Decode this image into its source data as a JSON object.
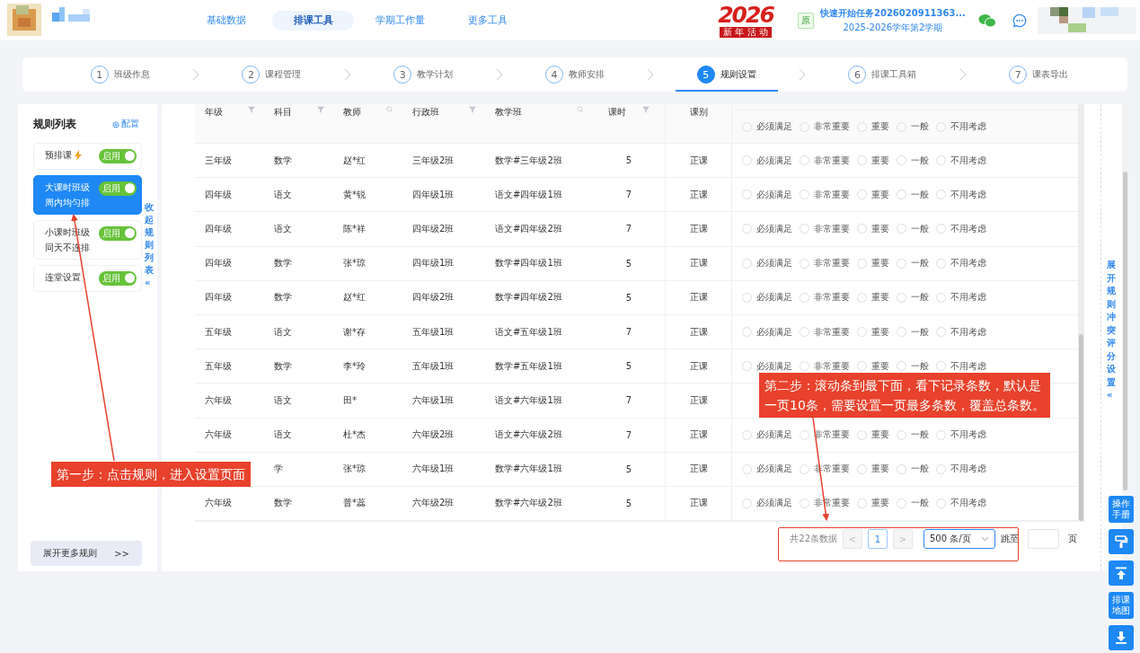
{
  "header": {
    "nav": [
      {
        "label": "基础数据",
        "selected": false
      },
      {
        "label": "排课工具",
        "selected": true
      },
      {
        "label": "学期工作量",
        "selected": false
      },
      {
        "label": "更多工具",
        "selected": false
      }
    ],
    "banner": {
      "year": "2026",
      "caption": "新 年 活 动"
    },
    "task": {
      "badge": "原",
      "title": "快速开始任务2026020911363...",
      "term": "2025-2026学年第2学期"
    }
  },
  "steps": [
    {
      "number": "1",
      "label": "班级作息",
      "selected": false
    },
    {
      "number": "2",
      "label": "课程管理",
      "selected": false
    },
    {
      "number": "3",
      "label": "教学计划",
      "selected": false
    },
    {
      "number": "4",
      "label": "教师安排",
      "selected": false
    },
    {
      "number": "5",
      "label": "规则设置",
      "selected": true
    },
    {
      "number": "6",
      "label": "排课工具箱",
      "selected": false
    },
    {
      "number": "7",
      "label": "课表导出",
      "selected": false
    }
  ],
  "rules_panel": {
    "title": "规则列表",
    "config_link": "配置",
    "collapse": "收起规则列表",
    "collapse_arrow": "«",
    "more_button": "展开更多规则",
    "more_arrow": ">>",
    "rules": [
      {
        "kind": "flash",
        "lines": [
          "预排课"
        ],
        "switch_label": "启用",
        "on": true,
        "selected": false
      },
      {
        "kind": "plain",
        "lines": [
          "大课时班级",
          "周内均匀排"
        ],
        "switch_label": "启用",
        "on": true,
        "selected": true
      },
      {
        "kind": "plain",
        "lines": [
          "小课时班级",
          "同天不连排"
        ],
        "switch_label": "启用",
        "on": true,
        "selected": false
      },
      {
        "kind": "plain",
        "lines": [
          "连堂设置"
        ],
        "switch_label": "启用",
        "on": true,
        "selected": false
      }
    ]
  },
  "table": {
    "columns": [
      {
        "label": "年级",
        "kind": "filter"
      },
      {
        "label": "科目",
        "kind": "filter"
      },
      {
        "label": "教师",
        "kind": "search"
      },
      {
        "label": "行政班",
        "kind": "filter"
      },
      {
        "label": "教学班",
        "kind": "search"
      },
      {
        "label": "课时",
        "kind": "filter"
      },
      {
        "label": "课别",
        "kind": "none"
      }
    ],
    "header_options": [
      {
        "label": "必须满足",
        "selected": false
      },
      {
        "label": "非常重要",
        "selected": false
      },
      {
        "label": "重要",
        "selected": false
      },
      {
        "label": "一般",
        "selected": false
      },
      {
        "label": "不用考虑",
        "selected": false
      }
    ],
    "rows": [
      {
        "cells": [
          "三年级",
          "数学",
          "赵*红",
          "三年级2班",
          "数学#三年级2班",
          "5",
          "正课"
        ],
        "options": [
          {
            "label": "必须满足",
            "selected": false
          },
          {
            "label": "非常重要",
            "selected": false
          },
          {
            "label": "重要",
            "selected": false
          },
          {
            "label": "一般",
            "selected": false
          },
          {
            "label": "不用考虑",
            "selected": false
          }
        ]
      },
      {
        "cells": [
          "四年级",
          "语文",
          "黄*锐",
          "四年级1班",
          "语文#四年级1班",
          "7",
          "正课"
        ],
        "options": [
          {
            "label": "必须满足",
            "selected": false
          },
          {
            "label": "非常重要",
            "selected": false
          },
          {
            "label": "重要",
            "selected": false
          },
          {
            "label": "一般",
            "selected": false
          },
          {
            "label": "不用考虑",
            "selected": false
          }
        ]
      },
      {
        "cells": [
          "四年级",
          "语文",
          "陈*祥",
          "四年级2班",
          "语文#四年级2班",
          "7",
          "正课"
        ],
        "options": [
          {
            "label": "必须满足",
            "selected": false
          },
          {
            "label": "非常重要",
            "selected": false
          },
          {
            "label": "重要",
            "selected": false
          },
          {
            "label": "一般",
            "selected": false
          },
          {
            "label": "不用考虑",
            "selected": false
          }
        ]
      },
      {
        "cells": [
          "四年级",
          "数学",
          "张*琼",
          "四年级1班",
          "数学#四年级1班",
          "5",
          "正课"
        ],
        "options": [
          {
            "label": "必须满足",
            "selected": false
          },
          {
            "label": "非常重要",
            "selected": false
          },
          {
            "label": "重要",
            "selected": false
          },
          {
            "label": "一般",
            "selected": false
          },
          {
            "label": "不用考虑",
            "selected": false
          }
        ]
      },
      {
        "cells": [
          "四年级",
          "数学",
          "赵*红",
          "四年级2班",
          "数学#四年级2班",
          "5",
          "正课"
        ],
        "options": [
          {
            "label": "必须满足",
            "selected": false
          },
          {
            "label": "非常重要",
            "selected": false
          },
          {
            "label": "重要",
            "selected": false
          },
          {
            "label": "一般",
            "selected": false
          },
          {
            "label": "不用考虑",
            "selected": false
          }
        ]
      },
      {
        "cells": [
          "五年级",
          "语文",
          "谢*存",
          "五年级1班",
          "语文#五年级1班",
          "7",
          "正课"
        ],
        "options": [
          {
            "label": "必须满足",
            "selected": false
          },
          {
            "label": "非常重要",
            "selected": false
          },
          {
            "label": "重要",
            "selected": false
          },
          {
            "label": "一般",
            "selected": false
          },
          {
            "label": "不用考虑",
            "selected": false
          }
        ]
      },
      {
        "cells": [
          "五年级",
          "数学",
          "李*玲",
          "五年级1班",
          "数学#五年级1班",
          "5",
          "正课"
        ],
        "options": [
          {
            "label": "必须满足",
            "selected": false
          },
          {
            "label": "非常重要",
            "selected": false
          },
          {
            "label": "重要",
            "selected": false
          },
          {
            "label": "一般",
            "selected": false
          },
          {
            "label": "不用考虑",
            "selected": false
          }
        ]
      },
      {
        "cells": [
          "六年级",
          "语文",
          "田*",
          "六年级1班",
          "语文#六年级1班",
          "7",
          "正课"
        ]
      },
      {
        "cells": [
          "六年级",
          "语文",
          "杜*杰",
          "六年级2班",
          "语文#六年级2班",
          "7",
          "正课"
        ],
        "options": [
          {
            "label": "必须满足",
            "selected": false
          },
          {
            "label": "非常重要",
            "selected": false
          },
          {
            "label": "重要",
            "selected": false
          },
          {
            "label": "一般",
            "selected": false
          },
          {
            "label": "不用考虑",
            "selected": false
          }
        ]
      },
      {
        "cells": [
          "",
          "学",
          "张*琼",
          "六年级1班",
          "数学#六年级1班",
          "5",
          "正课"
        ],
        "options": [
          {
            "label": "必须满足",
            "selected": false
          },
          {
            "label": "非常重要",
            "selected": false
          },
          {
            "label": "重要",
            "selected": false
          },
          {
            "label": "一般",
            "selected": false
          },
          {
            "label": "不用考虑",
            "selected": false
          }
        ]
      },
      {
        "cells": [
          "六年级",
          "数学",
          "普*蕊",
          "六年级2班",
          "数学#六年级2班",
          "5",
          "正课"
        ],
        "options": [
          {
            "label": "必须满足",
            "selected": false
          },
          {
            "label": "非常重要",
            "selected": false
          },
          {
            "label": "重要",
            "selected": false
          },
          {
            "label": "一般",
            "selected": false
          },
          {
            "label": "不用考虑",
            "selected": false
          }
        ]
      }
    ]
  },
  "pagination": {
    "total": "共22条数据",
    "prev": "<",
    "page": "1",
    "next": ">",
    "page_size": "500 条/页",
    "jump_label": "跳至",
    "page_unit": "页"
  },
  "side_strip": {
    "label": "展开规则冲突评分设置",
    "arrow": "«"
  },
  "float_buttons": [
    {
      "kind": "text",
      "label": "操作手册"
    },
    {
      "kind": "brush"
    },
    {
      "kind": "top"
    },
    {
      "kind": "text",
      "label": "排课地图"
    },
    {
      "kind": "download"
    }
  ],
  "annotations": [
    {
      "kind": "step1",
      "lines": [
        "第一步：点击规则，进入设置页面"
      ]
    },
    {
      "kind": "step2",
      "lines": [
        "第二步：滚动条到最下面，看下记录条数，默认是",
        "一页10条，需要设置一页最多条数，覆盖总条数。"
      ]
    }
  ]
}
